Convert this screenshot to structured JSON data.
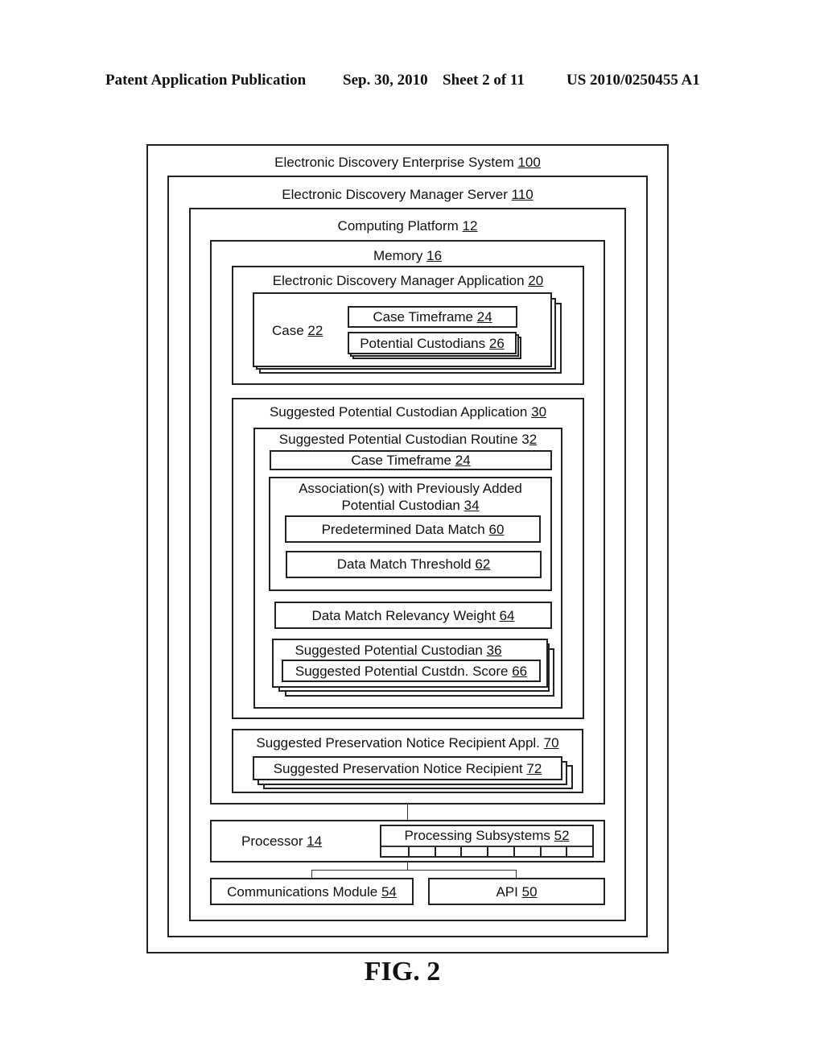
{
  "header": {
    "left": "Patent Application Publication",
    "date": "Sep. 30, 2010",
    "sheet": "Sheet 2 of 11",
    "number": "US 2010/0250455 A1"
  },
  "diagram": {
    "system": {
      "name": "Electronic Discovery Enterprise System",
      "ref": "100"
    },
    "server": {
      "name": "Electronic Discovery Manager Server",
      "ref": "110"
    },
    "platform": {
      "name": "Computing Platform",
      "ref": "12"
    },
    "memory": {
      "name": "Memory",
      "ref": "16"
    },
    "edm_app": {
      "name": "Electronic Discovery Manager Application",
      "ref": "20"
    },
    "case": {
      "name": "Case",
      "ref": "22"
    },
    "case_timeframe": {
      "name": "Case Timeframe",
      "ref": "24"
    },
    "potential_custodians": {
      "name": "Potential Custodians",
      "ref": "26"
    },
    "spc_app": {
      "name": "Suggested Potential Custodian Application",
      "ref": "30"
    },
    "spc_routine": {
      "name": "Suggested Potential Custodian Routine 3",
      "ref": "2"
    },
    "routine_timeframe": {
      "name": "Case Timeframe",
      "ref": "24"
    },
    "associations": {
      "name_line1": "Association(s) with Previously Added",
      "name_line2": "Potential Custodian",
      "ref": "34"
    },
    "predetermined_match": {
      "name": "Predetermined Data Match",
      "ref": "60"
    },
    "match_threshold": {
      "name": "Data Match Threshold",
      "ref": "62"
    },
    "relevancy_weight": {
      "name": "Data Match Relevancy Weight",
      "ref": "64"
    },
    "suggested_custodian": {
      "name": "Suggested Potential Custodian",
      "ref": "36"
    },
    "custodian_score": {
      "name": "Suggested Potential Custdn. Score",
      "ref": "66"
    },
    "spnr_app": {
      "name": "Suggested Preservation Notice Recipient Appl.",
      "ref": "70"
    },
    "spnr": {
      "name": "Suggested Preservation Notice Recipient",
      "ref": "72"
    },
    "processor": {
      "name": "Processor",
      "ref": "14"
    },
    "subsystems": {
      "name": "Processing Subsystems",
      "ref": "52",
      "cell_count": 8
    },
    "comms": {
      "name": "Communications Module ",
      "ref": "54"
    },
    "api": {
      "name": "API",
      "ref": "50"
    }
  },
  "figure_label": "FIG. 2"
}
